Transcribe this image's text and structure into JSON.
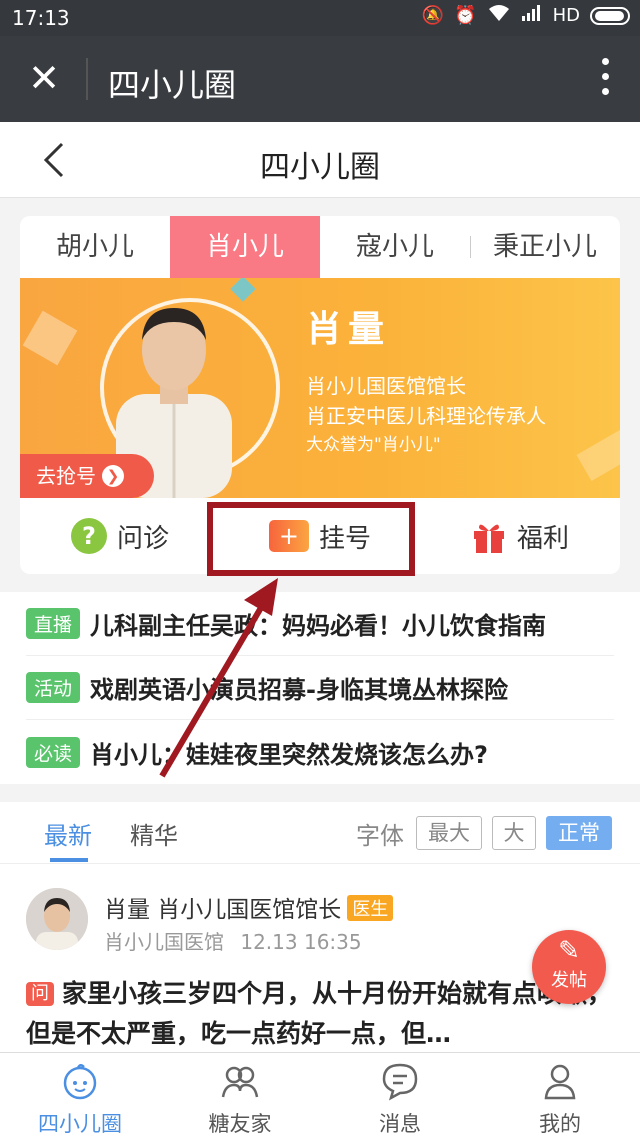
{
  "status_bar": {
    "time": "17:13",
    "network": "HD"
  },
  "wechat_bar": {
    "title": "四小儿圈"
  },
  "page": {
    "title": "四小儿圈"
  },
  "tabs": [
    "胡小儿",
    "肖小儿",
    "寇小儿",
    "秉正小儿"
  ],
  "banner": {
    "name": "肖量",
    "lines": [
      "肖小儿国医馆馆长",
      "肖正安中医儿科理论传承人",
      "大众誉为\"肖小儿\""
    ],
    "grab_button": "去抢号"
  },
  "actions": {
    "consult": "问诊",
    "register": "挂号",
    "welfare": "福利"
  },
  "news": [
    {
      "tag": "直播",
      "text": "儿科副主任吴政：妈妈必看！小儿饮食指南"
    },
    {
      "tag": "活动",
      "text": "戏剧英语小演员招募-身临其境丛林探险"
    },
    {
      "tag": "必读",
      "text": "肖小儿：娃娃夜里突然发烧该怎么办?"
    }
  ],
  "feed": {
    "tab_latest": "最新",
    "tab_featured": "精华",
    "font_label": "字体",
    "font_options": [
      "最大",
      "大",
      "正常"
    ],
    "post": {
      "author": "肖量 肖小儿国医馆馆长",
      "badge": "医生",
      "source": "肖小儿国医馆",
      "time": "12.13 16:35",
      "q_tag": "问",
      "text": "家里小孩三岁四个月，从十月份开始就有点咳嗽，但是不太严重，吃一点药好一点，但…"
    }
  },
  "fab": {
    "label": "发帖"
  },
  "tabbar": [
    "四小儿圈",
    "糖友家",
    "消息",
    "我的"
  ],
  "colors": {
    "accent": "#4b8fe2",
    "tab_active": "#f97a84",
    "highlight_box": "#a01820"
  }
}
